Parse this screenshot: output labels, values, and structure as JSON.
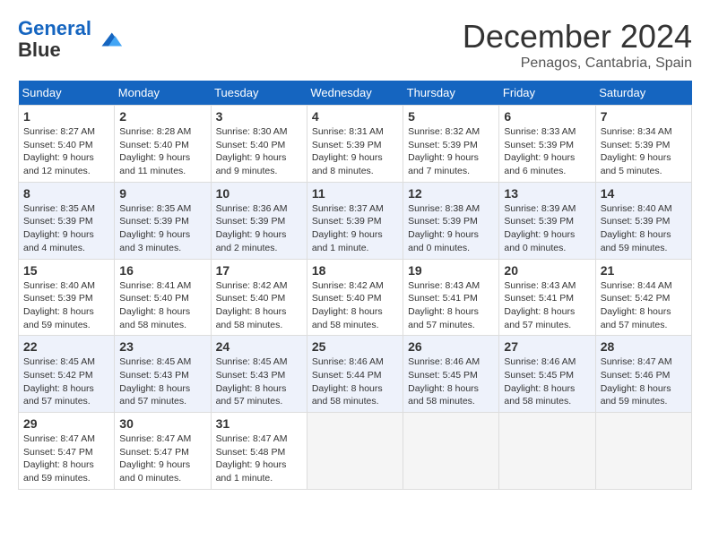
{
  "logo": {
    "line1": "General",
    "line2": "Blue"
  },
  "title": "December 2024",
  "location": "Penagos, Cantabria, Spain",
  "weekdays": [
    "Sunday",
    "Monday",
    "Tuesday",
    "Wednesday",
    "Thursday",
    "Friday",
    "Saturday"
  ],
  "weeks": [
    [
      {
        "day": "1",
        "sunrise": "8:27 AM",
        "sunset": "5:40 PM",
        "daylight": "9 hours and 12 minutes."
      },
      {
        "day": "2",
        "sunrise": "8:28 AM",
        "sunset": "5:40 PM",
        "daylight": "9 hours and 11 minutes."
      },
      {
        "day": "3",
        "sunrise": "8:30 AM",
        "sunset": "5:40 PM",
        "daylight": "9 hours and 9 minutes."
      },
      {
        "day": "4",
        "sunrise": "8:31 AM",
        "sunset": "5:39 PM",
        "daylight": "9 hours and 8 minutes."
      },
      {
        "day": "5",
        "sunrise": "8:32 AM",
        "sunset": "5:39 PM",
        "daylight": "9 hours and 7 minutes."
      },
      {
        "day": "6",
        "sunrise": "8:33 AM",
        "sunset": "5:39 PM",
        "daylight": "9 hours and 6 minutes."
      },
      {
        "day": "7",
        "sunrise": "8:34 AM",
        "sunset": "5:39 PM",
        "daylight": "9 hours and 5 minutes."
      }
    ],
    [
      {
        "day": "8",
        "sunrise": "8:35 AM",
        "sunset": "5:39 PM",
        "daylight": "9 hours and 4 minutes."
      },
      {
        "day": "9",
        "sunrise": "8:35 AM",
        "sunset": "5:39 PM",
        "daylight": "9 hours and 3 minutes."
      },
      {
        "day": "10",
        "sunrise": "8:36 AM",
        "sunset": "5:39 PM",
        "daylight": "9 hours and 2 minutes."
      },
      {
        "day": "11",
        "sunrise": "8:37 AM",
        "sunset": "5:39 PM",
        "daylight": "9 hours and 1 minute."
      },
      {
        "day": "12",
        "sunrise": "8:38 AM",
        "sunset": "5:39 PM",
        "daylight": "9 hours and 0 minutes."
      },
      {
        "day": "13",
        "sunrise": "8:39 AM",
        "sunset": "5:39 PM",
        "daylight": "9 hours and 0 minutes."
      },
      {
        "day": "14",
        "sunrise": "8:40 AM",
        "sunset": "5:39 PM",
        "daylight": "8 hours and 59 minutes."
      }
    ],
    [
      {
        "day": "15",
        "sunrise": "8:40 AM",
        "sunset": "5:39 PM",
        "daylight": "8 hours and 59 minutes."
      },
      {
        "day": "16",
        "sunrise": "8:41 AM",
        "sunset": "5:40 PM",
        "daylight": "8 hours and 58 minutes."
      },
      {
        "day": "17",
        "sunrise": "8:42 AM",
        "sunset": "5:40 PM",
        "daylight": "8 hours and 58 minutes."
      },
      {
        "day": "18",
        "sunrise": "8:42 AM",
        "sunset": "5:40 PM",
        "daylight": "8 hours and 58 minutes."
      },
      {
        "day": "19",
        "sunrise": "8:43 AM",
        "sunset": "5:41 PM",
        "daylight": "8 hours and 57 minutes."
      },
      {
        "day": "20",
        "sunrise": "8:43 AM",
        "sunset": "5:41 PM",
        "daylight": "8 hours and 57 minutes."
      },
      {
        "day": "21",
        "sunrise": "8:44 AM",
        "sunset": "5:42 PM",
        "daylight": "8 hours and 57 minutes."
      }
    ],
    [
      {
        "day": "22",
        "sunrise": "8:45 AM",
        "sunset": "5:42 PM",
        "daylight": "8 hours and 57 minutes."
      },
      {
        "day": "23",
        "sunrise": "8:45 AM",
        "sunset": "5:43 PM",
        "daylight": "8 hours and 57 minutes."
      },
      {
        "day": "24",
        "sunrise": "8:45 AM",
        "sunset": "5:43 PM",
        "daylight": "8 hours and 57 minutes."
      },
      {
        "day": "25",
        "sunrise": "8:46 AM",
        "sunset": "5:44 PM",
        "daylight": "8 hours and 58 minutes."
      },
      {
        "day": "26",
        "sunrise": "8:46 AM",
        "sunset": "5:45 PM",
        "daylight": "8 hours and 58 minutes."
      },
      {
        "day": "27",
        "sunrise": "8:46 AM",
        "sunset": "5:45 PM",
        "daylight": "8 hours and 58 minutes."
      },
      {
        "day": "28",
        "sunrise": "8:47 AM",
        "sunset": "5:46 PM",
        "daylight": "8 hours and 59 minutes."
      }
    ],
    [
      {
        "day": "29",
        "sunrise": "8:47 AM",
        "sunset": "5:47 PM",
        "daylight": "8 hours and 59 minutes."
      },
      {
        "day": "30",
        "sunrise": "8:47 AM",
        "sunset": "5:47 PM",
        "daylight": "9 hours and 0 minutes."
      },
      {
        "day": "31",
        "sunrise": "8:47 AM",
        "sunset": "5:48 PM",
        "daylight": "9 hours and 1 minute."
      },
      null,
      null,
      null,
      null
    ]
  ],
  "colors": {
    "header_bg": "#1565C0",
    "row_even_bg": "#eef2fb",
    "row_odd_bg": "#ffffff",
    "empty_bg": "#f5f5f5"
  }
}
